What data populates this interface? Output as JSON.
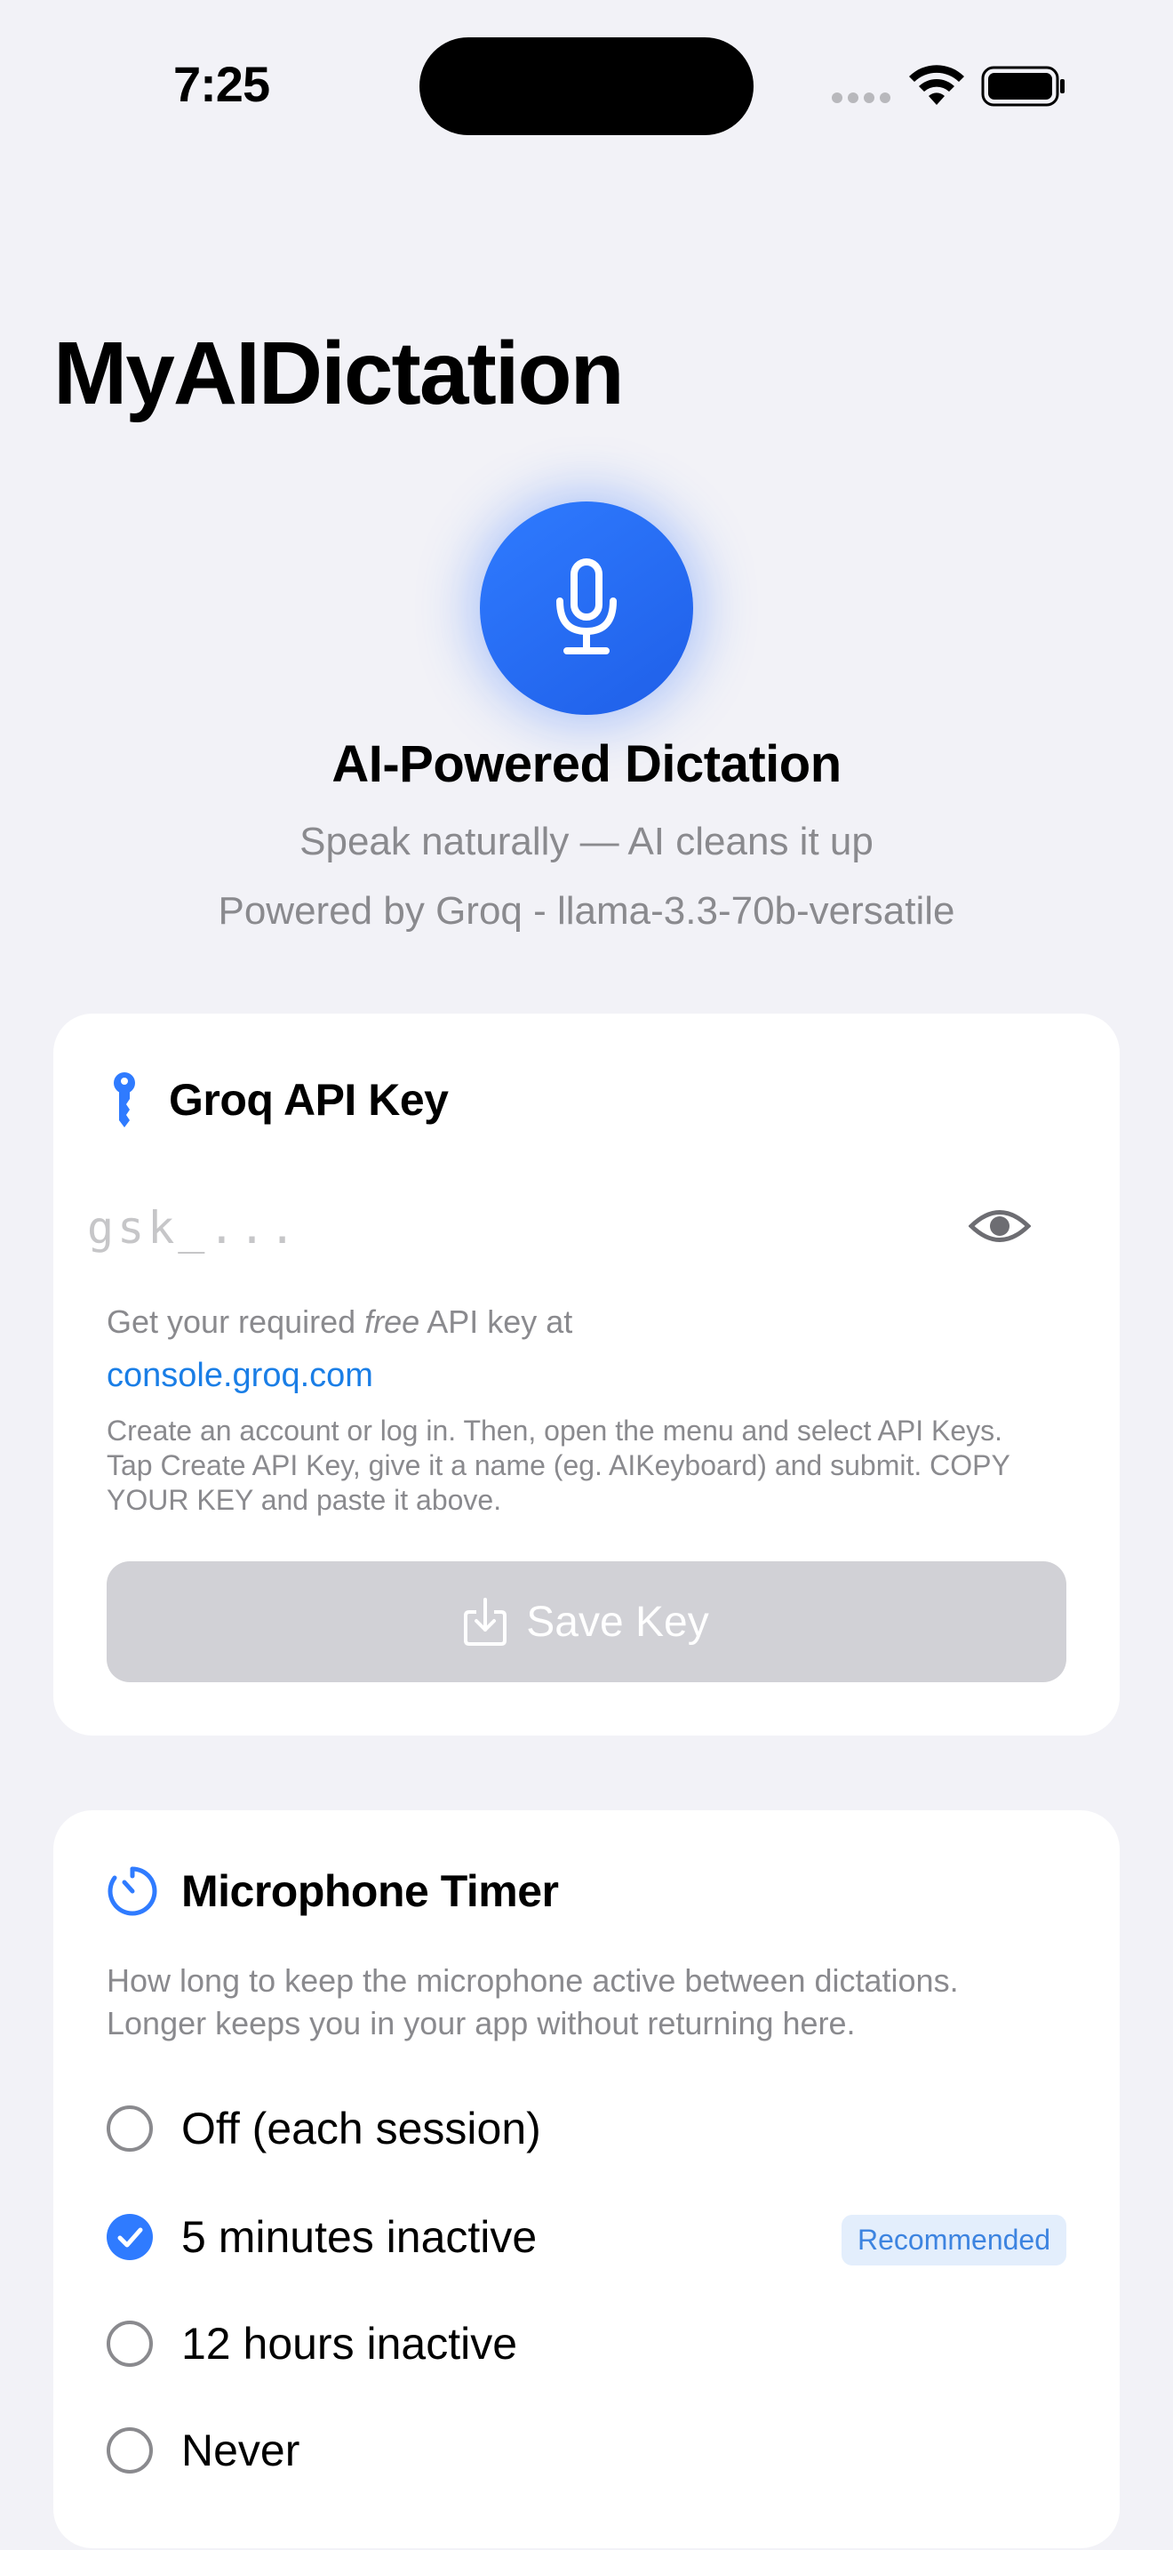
{
  "status_bar": {
    "time": "7:25"
  },
  "app": {
    "title": "MyAIDictation"
  },
  "hero": {
    "title": "AI-Powered Dictation",
    "subtitle": "Speak naturally — AI cleans it up",
    "powered_by": "Powered by Groq - llama-3.3-70b-versatile"
  },
  "api_card": {
    "title": "Groq API Key",
    "input_placeholder": "gsk_...",
    "input_value": "",
    "help_prefix": "Get your required ",
    "help_emphasis": "free",
    "help_suffix": " API key at",
    "link_text": "console.groq.com",
    "instructions": "Create an account or log in. Then, open the menu and select API Keys. Tap Create API Key, give it a name (eg. AIKeyboard) and submit. COPY YOUR KEY and paste it above.",
    "save_label": "Save Key"
  },
  "timer_card": {
    "title": "Microphone Timer",
    "description": "How long to keep the microphone active between dictations. Longer keeps you in your app without returning here.",
    "options": [
      {
        "label": "Off (each session)",
        "selected": false
      },
      {
        "label": "5 minutes inactive",
        "selected": true,
        "badge": "Recommended"
      },
      {
        "label": "12 hours inactive",
        "selected": false
      },
      {
        "label": "Never",
        "selected": false
      }
    ]
  },
  "colors": {
    "accent": "#2f7bff",
    "background": "#f2f2f7",
    "secondary_text": "#8a8a8e",
    "link": "#1a7ee6",
    "disabled_button": "#d1d1d6"
  },
  "icons": [
    "mic-icon",
    "key-icon",
    "eye-icon",
    "save-icon",
    "timer-icon",
    "checkmark-icon",
    "wifi-icon",
    "battery-icon"
  ]
}
